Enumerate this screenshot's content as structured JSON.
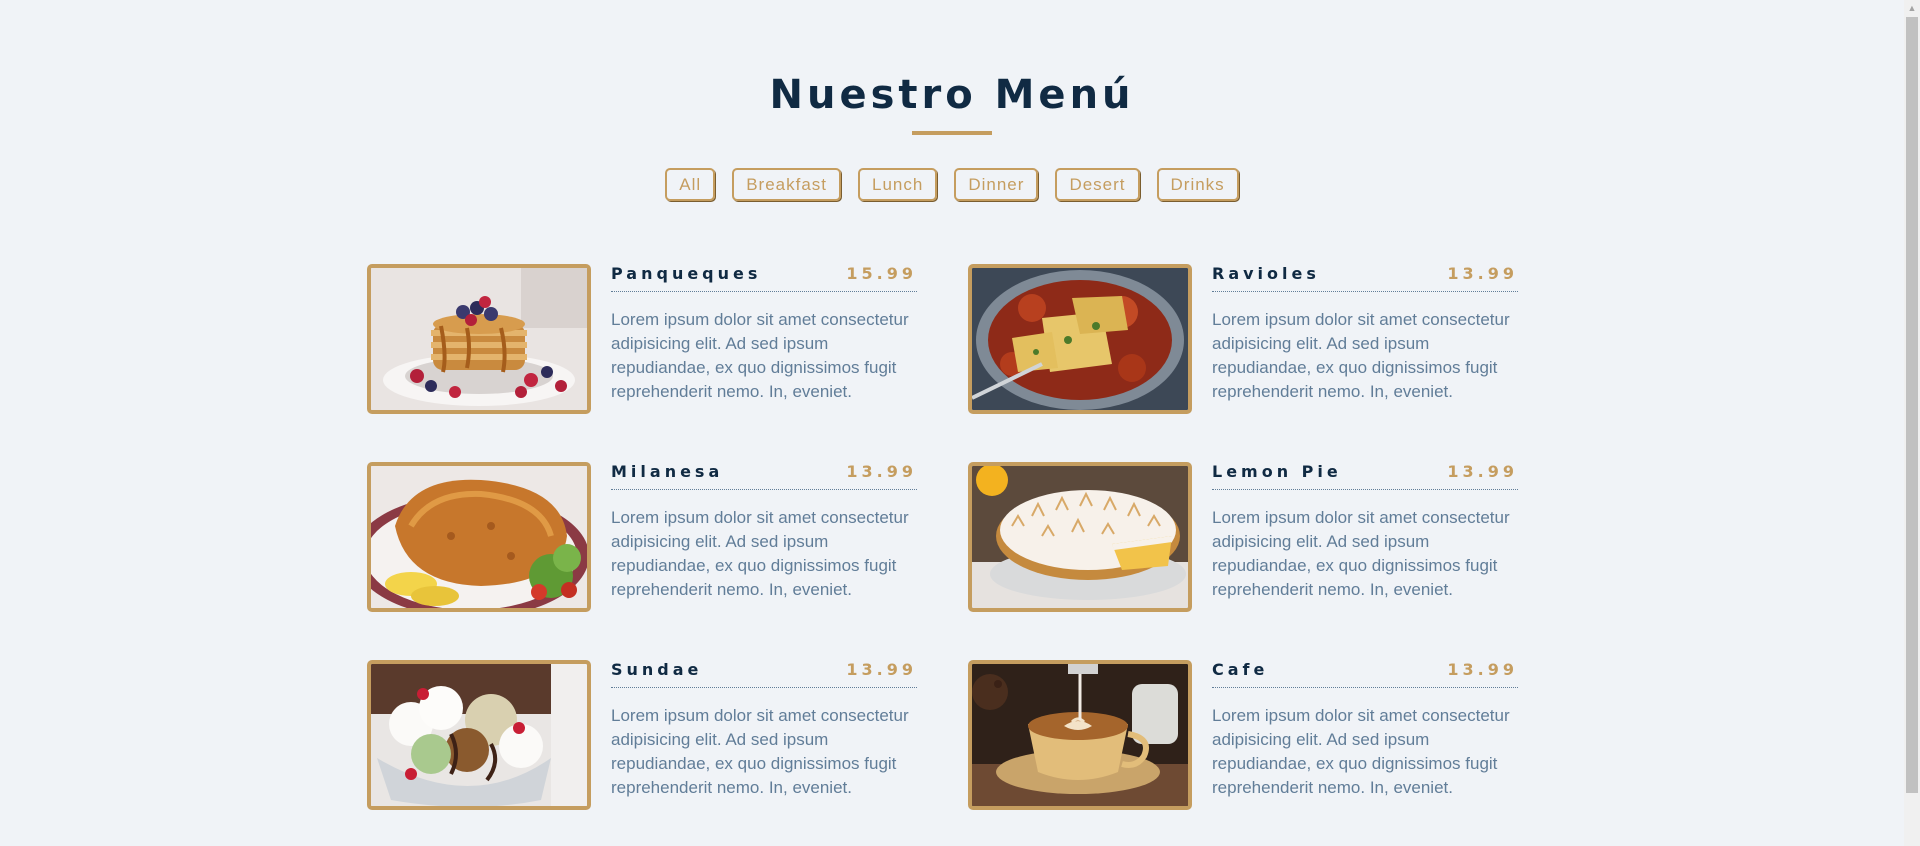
{
  "header": {
    "title": "Nuestro Menú"
  },
  "filters": [
    "All",
    "Breakfast",
    "Lunch",
    "Dinner",
    "Desert",
    "Drinks"
  ],
  "colors": {
    "accent": "#c59d5f",
    "heading": "#102a43",
    "text": "#617d98",
    "background": "#f0f3f7"
  },
  "items": [
    {
      "name": "Panqueques",
      "price": "15.99",
      "photo": "pancakes-photo",
      "desc": "Lorem ipsum dolor sit amet consectetur adipisicing elit. Ad sed ipsum repudiandae, ex quo dignissimos fugit reprehenderit nemo. In, eveniet."
    },
    {
      "name": "Ravioles",
      "price": "13.99",
      "photo": "ravioli-photo",
      "desc": "Lorem ipsum dolor sit amet consectetur adipisicing elit. Ad sed ipsum repudiandae, ex quo dignissimos fugit reprehenderit nemo. In, eveniet."
    },
    {
      "name": "Milanesa",
      "price": "13.99",
      "photo": "milanesa-photo",
      "desc": "Lorem ipsum dolor sit amet consectetur adipisicing elit. Ad sed ipsum repudiandae, ex quo dignissimos fugit reprehenderit nemo. In, eveniet."
    },
    {
      "name": "Lemon Pie",
      "price": "13.99",
      "photo": "lemon-pie-photo",
      "desc": "Lorem ipsum dolor sit amet consectetur adipisicing elit. Ad sed ipsum repudiandae, ex quo dignissimos fugit reprehenderit nemo. In, eveniet."
    },
    {
      "name": "Sundae",
      "price": "13.99",
      "photo": "sundae-photo",
      "desc": "Lorem ipsum dolor sit amet consectetur adipisicing elit. Ad sed ipsum repudiandae, ex quo dignissimos fugit reprehenderit nemo. In, eveniet."
    },
    {
      "name": "Cafe",
      "price": "13.99",
      "photo": "coffee-photo",
      "desc": "Lorem ipsum dolor sit amet consectetur adipisicing elit. Ad sed ipsum repudiandae, ex quo dignissimos fugit reprehenderit nemo. In, eveniet."
    }
  ]
}
